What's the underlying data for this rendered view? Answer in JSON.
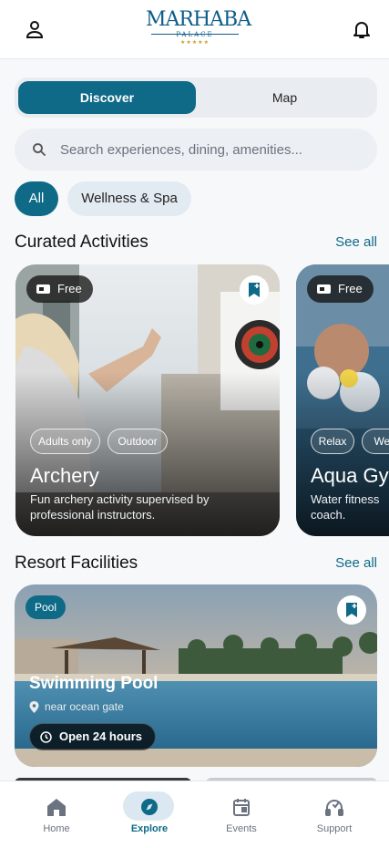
{
  "header": {
    "logo_word": "MARHABA",
    "logo_sub": "PALACE",
    "logo_stars": "★★★★★",
    "profile_icon": "user-icon",
    "notification_icon": "bell-icon"
  },
  "view_toggle": {
    "options": [
      "Discover",
      "Map"
    ],
    "selected": "Discover"
  },
  "search": {
    "placeholder": "Search experiences, dining, amenities...",
    "icon": "search-icon"
  },
  "filters": {
    "chips": [
      "All",
      "Wellness & Spa"
    ],
    "selected": "All"
  },
  "curated": {
    "title": "Curated Activities",
    "see_all": "See all",
    "cards": [
      {
        "price": "Free",
        "tags": [
          "Adults only",
          "Outdoor"
        ],
        "title": "Archery",
        "description": "Fun archery activity supervised by professional instructors."
      },
      {
        "price": "Free",
        "tags": [
          "Relax",
          "Well"
        ],
        "title": "Aqua Gy",
        "description": "Water fitness coach."
      }
    ]
  },
  "facilities": {
    "title": "Resort Facilities",
    "see_all": "See all",
    "cards": [
      {
        "category": "Pool",
        "title": "Swimming Pool",
        "location": "near ocean gate",
        "hours": "Open 24 hours"
      }
    ]
  },
  "tabbar": {
    "tabs": [
      {
        "label": "Home",
        "icon": "home-icon"
      },
      {
        "label": "Explore",
        "icon": "compass-icon"
      },
      {
        "label": "Events",
        "icon": "calendar-icon"
      },
      {
        "label": "Support",
        "icon": "headset-icon"
      }
    ],
    "active": "Explore"
  },
  "colors": {
    "brand": "#0f6a87",
    "logo": "#0d5d8a",
    "background": "#f7f8fa"
  }
}
